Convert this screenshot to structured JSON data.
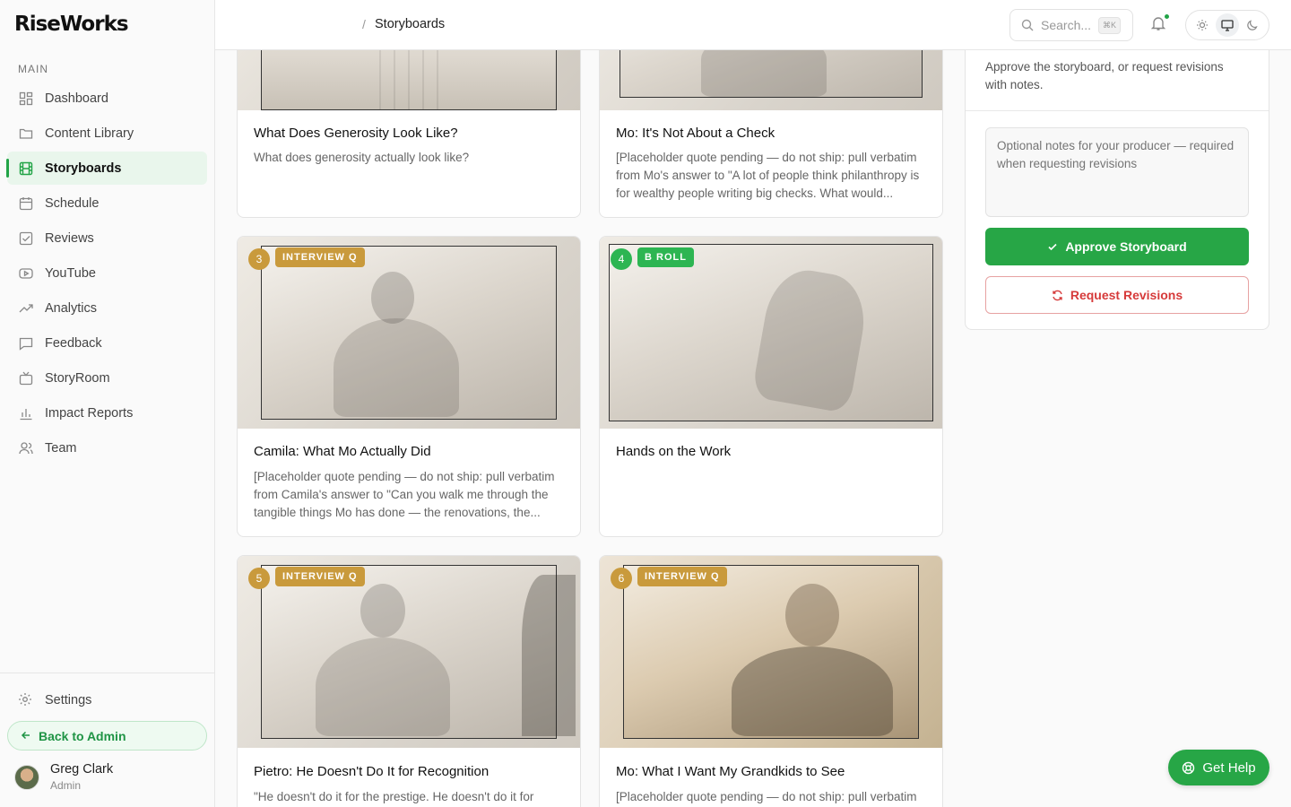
{
  "app": {
    "logo": "RiseWorks"
  },
  "sidebar": {
    "section_label": "MAIN",
    "items": [
      {
        "label": "Dashboard",
        "icon": "grid-icon"
      },
      {
        "label": "Content Library",
        "icon": "folder-icon"
      },
      {
        "label": "Storyboards",
        "icon": "film-icon",
        "active": true
      },
      {
        "label": "Schedule",
        "icon": "calendar-icon"
      },
      {
        "label": "Reviews",
        "icon": "checkbox-icon"
      },
      {
        "label": "YouTube",
        "icon": "youtube-icon"
      },
      {
        "label": "Analytics",
        "icon": "trend-icon"
      },
      {
        "label": "Feedback",
        "icon": "message-icon"
      },
      {
        "label": "StoryRoom",
        "icon": "tv-icon"
      },
      {
        "label": "Impact Reports",
        "icon": "bar-chart-icon"
      },
      {
        "label": "Team",
        "icon": "users-icon"
      }
    ],
    "settings_label": "Settings",
    "back_label": "Back to Admin",
    "user": {
      "name": "Greg Clark",
      "role": "Admin"
    }
  },
  "topbar": {
    "breadcrumb_sep": "/",
    "breadcrumb": "Storyboards",
    "search_placeholder": "Search...",
    "search_shortcut": "⌘K"
  },
  "cards": [
    {
      "title": "What Does Generosity Look Like?",
      "desc": "What does generosity actually look like?"
    },
    {
      "title": "Mo: It's Not About a Check",
      "desc": "[Placeholder quote pending — do not ship: pull verbatim from Mo's answer to \"A lot of people think philanthropy is for wealthy people writing big checks. What would..."
    },
    {
      "num": "3",
      "tag": "INTERVIEW Q",
      "title": "Camila: What Mo Actually Did",
      "desc": "[Placeholder quote pending — do not ship: pull verbatim from Camila's answer to \"Can you walk me through the tangible things Mo has done — the renovations, the..."
    },
    {
      "num": "4",
      "tag": "B ROLL",
      "title": "Hands on the Work",
      "desc": ""
    },
    {
      "num": "5",
      "tag": "INTERVIEW Q",
      "title": "Pietro: He Doesn't Do It for Recognition",
      "desc": "\"He doesn't do it for the prestige. He doesn't do it for"
    },
    {
      "num": "6",
      "tag": "INTERVIEW Q",
      "title": "Mo: What I Want My Grandkids to See",
      "desc": "[Placeholder quote pending — do not ship: pull verbatim"
    }
  ],
  "review_panel": {
    "instructions": "Approve the storyboard, or request revisions with notes.",
    "notes_placeholder": "Optional notes for your producer — required when requesting revisions",
    "approve_label": "Approve Storyboard",
    "revise_label": "Request Revisions"
  },
  "help": {
    "label": "Get Help"
  },
  "colors": {
    "accent": "#27a646",
    "tag_interview": "#c99a3c",
    "tag_broll": "#2db552",
    "danger": "#d63a3a"
  }
}
